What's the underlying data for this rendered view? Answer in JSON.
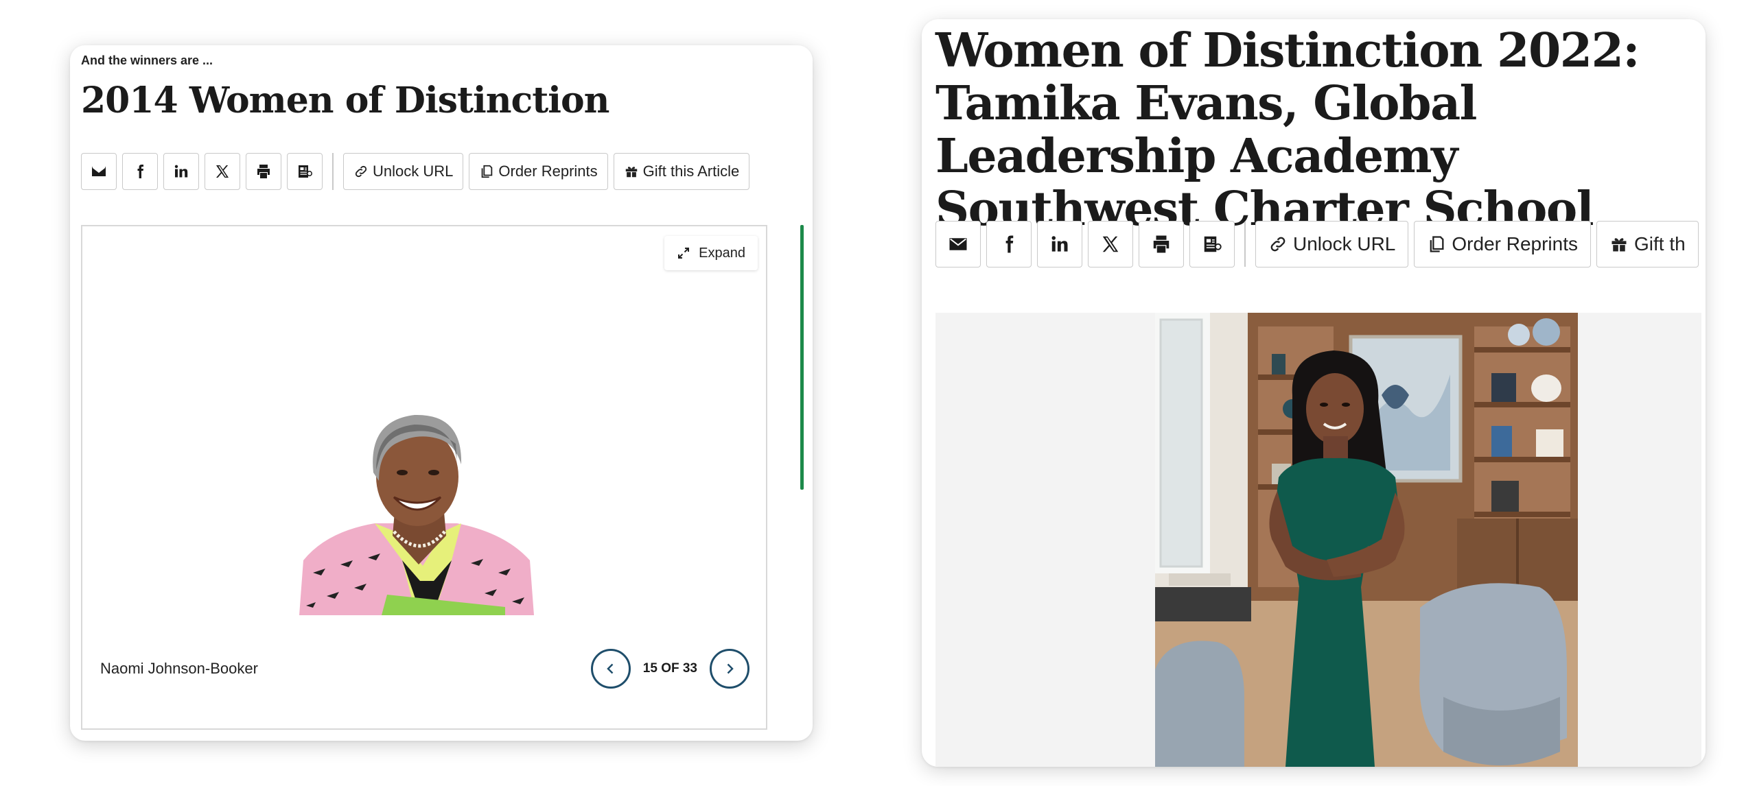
{
  "left_card": {
    "eyebrow": "And the winners are ...",
    "title": "2014 Women of Distinction",
    "toolbar": {
      "icons": [
        "email-icon",
        "facebook-icon",
        "linkedin-icon",
        "x-icon",
        "print-icon",
        "reprint-icon"
      ],
      "unlock_url_label": "Unlock URL",
      "order_reprints_label": "Order Reprints",
      "gift_article_label": "Gift this Article"
    },
    "gallery": {
      "expand_label": "Expand",
      "caption": "Naomi Johnson-Booker",
      "counter": "15 OF 33"
    }
  },
  "right_card": {
    "title": "Women of Distinction 2022: Tamika Evans, Global Leadership Academy Southwest Charter School",
    "toolbar": {
      "icons": [
        "email-icon",
        "facebook-icon",
        "linkedin-icon",
        "x-icon",
        "print-icon",
        "reprint-icon"
      ],
      "unlock_url_label": "Unlock URL",
      "order_reprints_label": "Order Reprints",
      "gift_article_label": "Gift th"
    }
  },
  "colors": {
    "scroll_accent": "#1d8a4a",
    "pager_accent": "#1f4e6b"
  }
}
